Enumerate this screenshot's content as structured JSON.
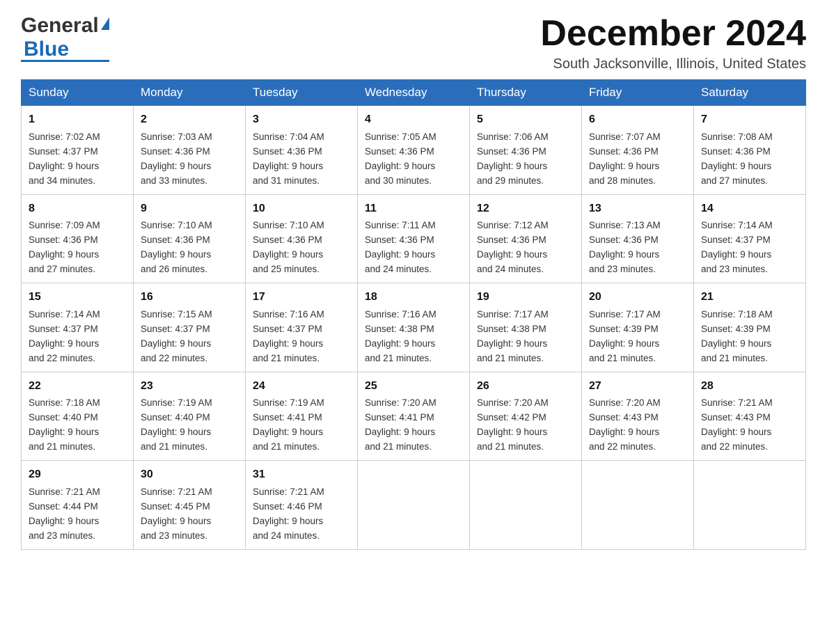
{
  "header": {
    "logo_general": "General",
    "logo_blue": "Blue",
    "month_title": "December 2024",
    "location": "South Jacksonville, Illinois, United States"
  },
  "weekdays": [
    "Sunday",
    "Monday",
    "Tuesday",
    "Wednesday",
    "Thursday",
    "Friday",
    "Saturday"
  ],
  "weeks": [
    [
      {
        "day": "1",
        "sunrise": "7:02 AM",
        "sunset": "4:37 PM",
        "daylight": "9 hours and 34 minutes."
      },
      {
        "day": "2",
        "sunrise": "7:03 AM",
        "sunset": "4:36 PM",
        "daylight": "9 hours and 33 minutes."
      },
      {
        "day": "3",
        "sunrise": "7:04 AM",
        "sunset": "4:36 PM",
        "daylight": "9 hours and 31 minutes."
      },
      {
        "day": "4",
        "sunrise": "7:05 AM",
        "sunset": "4:36 PM",
        "daylight": "9 hours and 30 minutes."
      },
      {
        "day": "5",
        "sunrise": "7:06 AM",
        "sunset": "4:36 PM",
        "daylight": "9 hours and 29 minutes."
      },
      {
        "day": "6",
        "sunrise": "7:07 AM",
        "sunset": "4:36 PM",
        "daylight": "9 hours and 28 minutes."
      },
      {
        "day": "7",
        "sunrise": "7:08 AM",
        "sunset": "4:36 PM",
        "daylight": "9 hours and 27 minutes."
      }
    ],
    [
      {
        "day": "8",
        "sunrise": "7:09 AM",
        "sunset": "4:36 PM",
        "daylight": "9 hours and 27 minutes."
      },
      {
        "day": "9",
        "sunrise": "7:10 AM",
        "sunset": "4:36 PM",
        "daylight": "9 hours and 26 minutes."
      },
      {
        "day": "10",
        "sunrise": "7:10 AM",
        "sunset": "4:36 PM",
        "daylight": "9 hours and 25 minutes."
      },
      {
        "day": "11",
        "sunrise": "7:11 AM",
        "sunset": "4:36 PM",
        "daylight": "9 hours and 24 minutes."
      },
      {
        "day": "12",
        "sunrise": "7:12 AM",
        "sunset": "4:36 PM",
        "daylight": "9 hours and 24 minutes."
      },
      {
        "day": "13",
        "sunrise": "7:13 AM",
        "sunset": "4:36 PM",
        "daylight": "9 hours and 23 minutes."
      },
      {
        "day": "14",
        "sunrise": "7:14 AM",
        "sunset": "4:37 PM",
        "daylight": "9 hours and 23 minutes."
      }
    ],
    [
      {
        "day": "15",
        "sunrise": "7:14 AM",
        "sunset": "4:37 PM",
        "daylight": "9 hours and 22 minutes."
      },
      {
        "day": "16",
        "sunrise": "7:15 AM",
        "sunset": "4:37 PM",
        "daylight": "9 hours and 22 minutes."
      },
      {
        "day": "17",
        "sunrise": "7:16 AM",
        "sunset": "4:37 PM",
        "daylight": "9 hours and 21 minutes."
      },
      {
        "day": "18",
        "sunrise": "7:16 AM",
        "sunset": "4:38 PM",
        "daylight": "9 hours and 21 minutes."
      },
      {
        "day": "19",
        "sunrise": "7:17 AM",
        "sunset": "4:38 PM",
        "daylight": "9 hours and 21 minutes."
      },
      {
        "day": "20",
        "sunrise": "7:17 AM",
        "sunset": "4:39 PM",
        "daylight": "9 hours and 21 minutes."
      },
      {
        "day": "21",
        "sunrise": "7:18 AM",
        "sunset": "4:39 PM",
        "daylight": "9 hours and 21 minutes."
      }
    ],
    [
      {
        "day": "22",
        "sunrise": "7:18 AM",
        "sunset": "4:40 PM",
        "daylight": "9 hours and 21 minutes."
      },
      {
        "day": "23",
        "sunrise": "7:19 AM",
        "sunset": "4:40 PM",
        "daylight": "9 hours and 21 minutes."
      },
      {
        "day": "24",
        "sunrise": "7:19 AM",
        "sunset": "4:41 PM",
        "daylight": "9 hours and 21 minutes."
      },
      {
        "day": "25",
        "sunrise": "7:20 AM",
        "sunset": "4:41 PM",
        "daylight": "9 hours and 21 minutes."
      },
      {
        "day": "26",
        "sunrise": "7:20 AM",
        "sunset": "4:42 PM",
        "daylight": "9 hours and 21 minutes."
      },
      {
        "day": "27",
        "sunrise": "7:20 AM",
        "sunset": "4:43 PM",
        "daylight": "9 hours and 22 minutes."
      },
      {
        "day": "28",
        "sunrise": "7:21 AM",
        "sunset": "4:43 PM",
        "daylight": "9 hours and 22 minutes."
      }
    ],
    [
      {
        "day": "29",
        "sunrise": "7:21 AM",
        "sunset": "4:44 PM",
        "daylight": "9 hours and 23 minutes."
      },
      {
        "day": "30",
        "sunrise": "7:21 AM",
        "sunset": "4:45 PM",
        "daylight": "9 hours and 23 minutes."
      },
      {
        "day": "31",
        "sunrise": "7:21 AM",
        "sunset": "4:46 PM",
        "daylight": "9 hours and 24 minutes."
      },
      null,
      null,
      null,
      null
    ]
  ],
  "labels": {
    "sunrise": "Sunrise:",
    "sunset": "Sunset:",
    "daylight": "Daylight:"
  }
}
